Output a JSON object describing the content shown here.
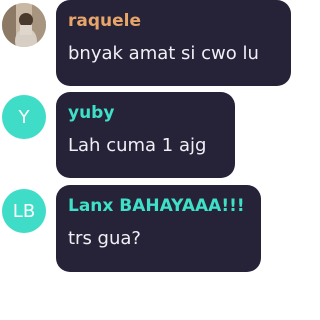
{
  "messages": [
    {
      "sender": "raquele",
      "sender_color": "#e8a56a",
      "text": "bnyak amat si cwo lu",
      "avatar_type": "photo"
    },
    {
      "sender": "yuby",
      "sender_color": "#3fe0c8",
      "text": "Lah cuma 1 ajg",
      "avatar_initials": "Y",
      "avatar_color": "#3fdcc8"
    },
    {
      "sender": "Lanx BAHAYAAA!!!",
      "sender_color": "#3fe0c8",
      "text": "trs gua?",
      "avatar_initials": "LB",
      "avatar_color": "#3fdcc8"
    }
  ],
  "colors": {
    "bubble_bg": "#262338",
    "page_bg": "#ffffff"
  }
}
